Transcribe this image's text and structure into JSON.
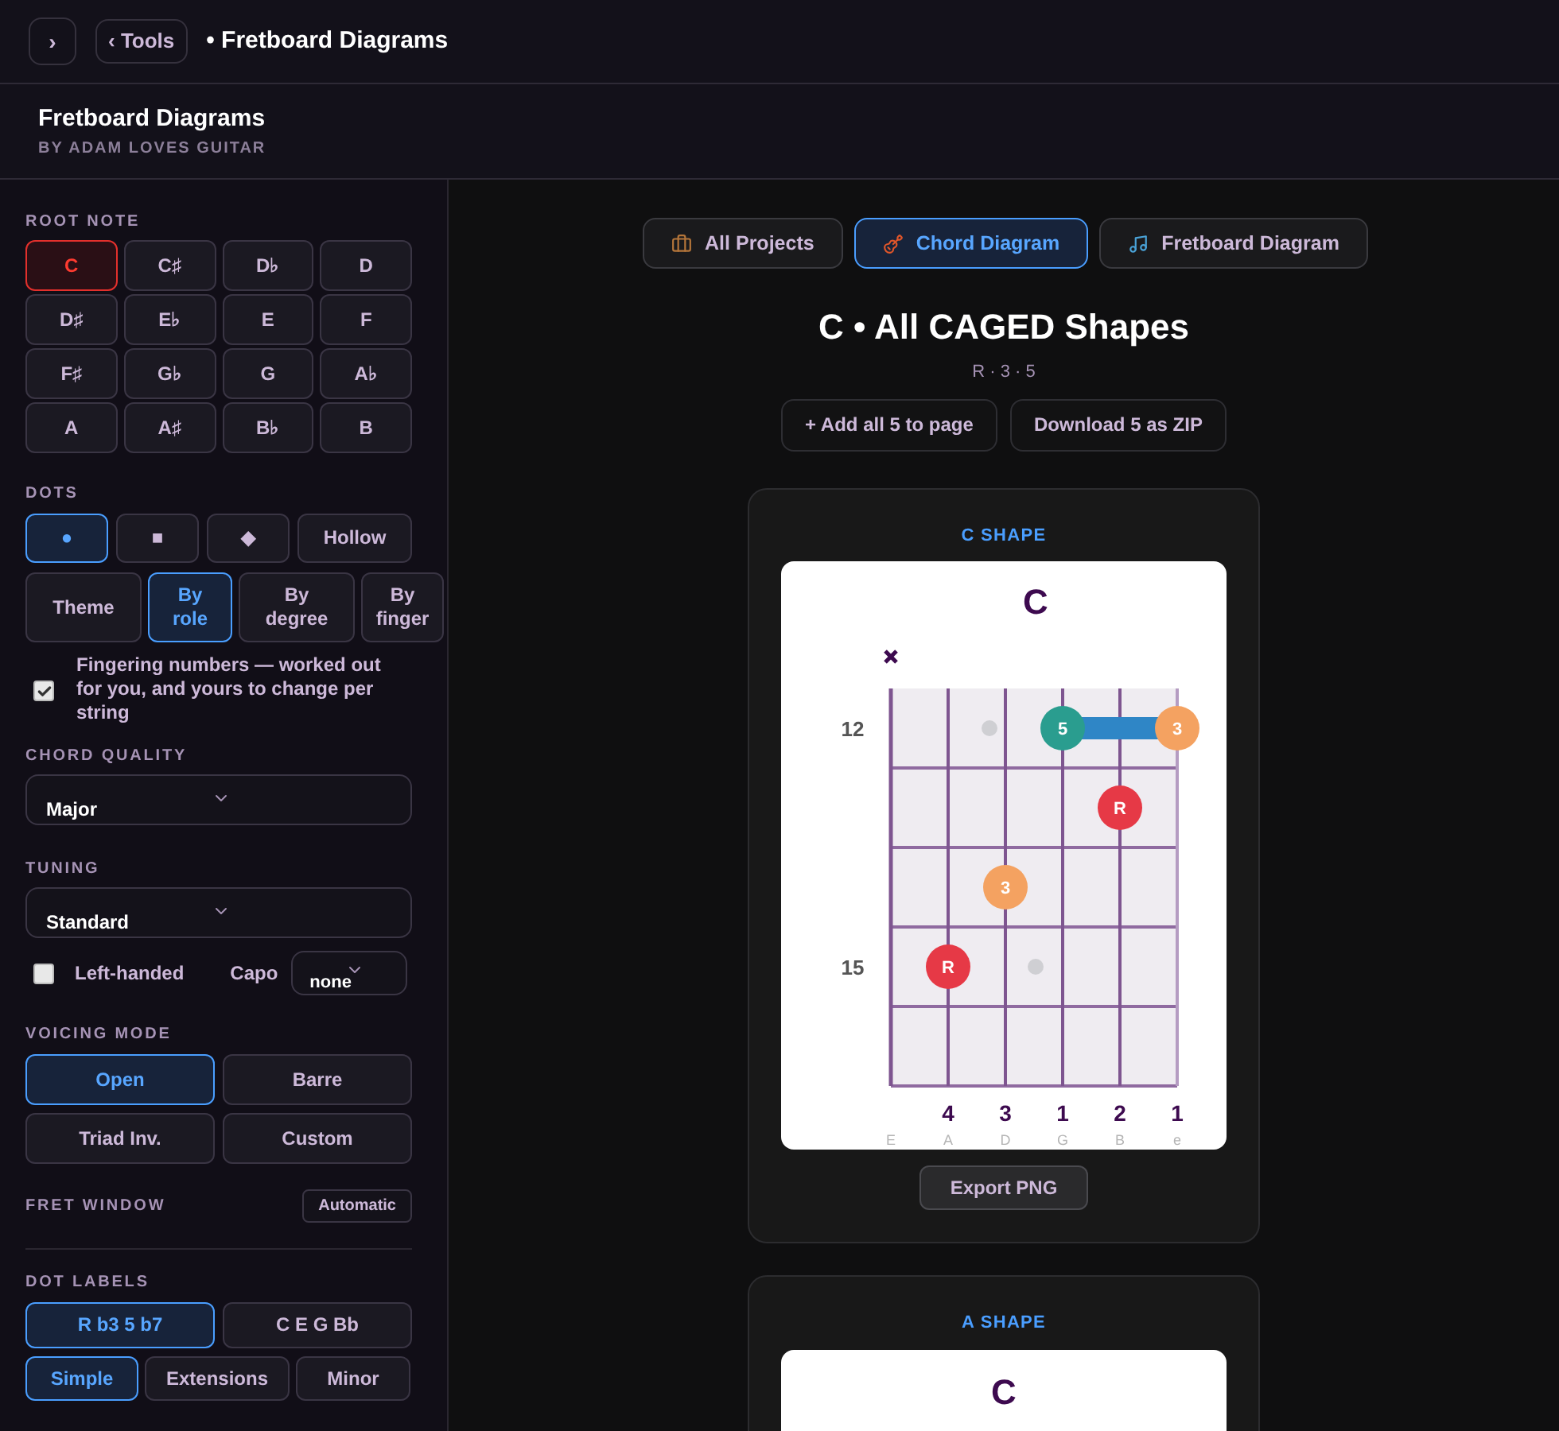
{
  "topbar": {
    "toggle": "›",
    "back": "‹ Tools",
    "breadcrumb": "• Fretboard Diagrams"
  },
  "header": {
    "title": "Fretboard Diagrams",
    "subtitle": "BY ADAM LOVES GUITAR"
  },
  "sidebar": {
    "root_note": {
      "label": "ROOT NOTE",
      "options": [
        {
          "label": "C",
          "selected": true
        },
        {
          "label": "C♯",
          "selected": false
        },
        {
          "label": "D♭",
          "selected": false
        },
        {
          "label": "D",
          "selected": false
        },
        {
          "label": "D♯",
          "selected": false
        },
        {
          "label": "E♭",
          "selected": false
        },
        {
          "label": "E",
          "selected": false
        },
        {
          "label": "F",
          "selected": false
        },
        {
          "label": "F♯",
          "selected": false
        },
        {
          "label": "G♭",
          "selected": false
        },
        {
          "label": "G",
          "selected": false
        },
        {
          "label": "A♭",
          "selected": false
        },
        {
          "label": "A",
          "selected": false
        },
        {
          "label": "A♯",
          "selected": false
        },
        {
          "label": "B♭",
          "selected": false
        },
        {
          "label": "B",
          "selected": false
        }
      ]
    },
    "dots": {
      "label": "DOTS",
      "shapes": [
        {
          "label": "●",
          "selected": true
        },
        {
          "label": "■",
          "selected": false
        },
        {
          "label": "◆",
          "selected": false
        },
        {
          "label": "Hollow",
          "selected": false
        }
      ],
      "coloring": [
        {
          "label": "Theme",
          "selected": false
        },
        {
          "label": "By role",
          "selected": true
        },
        {
          "label": "By degree",
          "selected": false
        },
        {
          "label": "By finger",
          "selected": false
        }
      ]
    },
    "fingering": {
      "label": "Fingering numbers — worked out for you, and yours to change per string",
      "checked": true
    },
    "chord_quality": {
      "label": "CHORD QUALITY",
      "value": "Major"
    },
    "tuning": {
      "label": "TUNING",
      "value": "Standard"
    },
    "left_handed": {
      "label": "Left-handed",
      "checked": false
    },
    "capo": {
      "label": "Capo",
      "value": "none"
    },
    "voicing_mode": {
      "label": "VOICING MODE",
      "options": [
        {
          "label": "Open",
          "selected": true
        },
        {
          "label": "Barre",
          "selected": false
        },
        {
          "label": "Triad Inv.",
          "selected": false
        },
        {
          "label": "Custom",
          "selected": false
        }
      ]
    },
    "fret_window": {
      "label": "FRET WINDOW",
      "value": "Automatic"
    },
    "dot_labels": {
      "label": "DOT LABELS",
      "styles": [
        {
          "label": "R b3 5 b7",
          "selected": true
        },
        {
          "label": "C E G Bb",
          "selected": false
        }
      ],
      "sets": [
        {
          "label": "Simple",
          "selected": true
        },
        {
          "label": "Extensions",
          "selected": false
        },
        {
          "label": "Minor",
          "selected": false
        }
      ]
    }
  },
  "main": {
    "tabs": [
      {
        "label": "All Projects",
        "selected": false
      },
      {
        "label": "Chord Diagram",
        "selected": true
      },
      {
        "label": "Fretboard Diagram",
        "selected": false
      }
    ],
    "title": "C • All CAGED Shapes",
    "formula": "R · 3 · 5",
    "actions": [
      "+ Add all 5 to page",
      "Download 5 as ZIP"
    ],
    "shapes": [
      {
        "title": "C SHAPE",
        "chord": "C",
        "export": "Export PNG",
        "strings": [
          {
            "name": "E",
            "muted": true
          },
          {
            "name": "A",
            "muted": false,
            "finger": "4"
          },
          {
            "name": "D",
            "muted": false,
            "finger": "3"
          },
          {
            "name": "G",
            "muted": false,
            "finger": "1"
          },
          {
            "name": "B",
            "muted": false,
            "finger": "2"
          },
          {
            "name": "e",
            "muted": false,
            "finger": "1"
          }
        ],
        "frets": [
          {
            "label": "12",
            "inlay": true,
            "barre": true,
            "cells": [
              {
                "kind": "empty"
              },
              {
                "kind": "empty"
              },
              {
                "kind": "empty"
              },
              {
                "kind": "dot",
                "label": "5",
                "color": "#2a9d8f"
              },
              {
                "kind": "empty"
              },
              {
                "kind": "dot",
                "label": "3",
                "color": "#f4a261"
              }
            ]
          },
          {
            "inlay": false,
            "barre": false,
            "cells": [
              {
                "kind": "empty"
              },
              {
                "kind": "empty"
              },
              {
                "kind": "empty"
              },
              {
                "kind": "empty"
              },
              {
                "kind": "dot",
                "label": "R",
                "color": "#e63946"
              },
              {
                "kind": "empty"
              }
            ]
          },
          {
            "inlay": false,
            "barre": false,
            "cells": [
              {
                "kind": "empty"
              },
              {
                "kind": "empty"
              },
              {
                "kind": "dot",
                "label": "3",
                "color": "#f4a261"
              },
              {
                "kind": "empty"
              },
              {
                "kind": "empty"
              },
              {
                "kind": "empty"
              }
            ]
          },
          {
            "label": "15",
            "inlay": true,
            "barre": false,
            "cells": [
              {
                "kind": "empty"
              },
              {
                "kind": "dot",
                "label": "R",
                "color": "#e63946"
              },
              {
                "kind": "empty"
              },
              {
                "kind": "empty"
              },
              {
                "kind": "empty"
              },
              {
                "kind": "empty"
              }
            ]
          },
          {
            "inlay": false,
            "barre": false,
            "cells": [
              {
                "kind": "empty"
              },
              {
                "kind": "empty"
              },
              {
                "kind": "empty"
              },
              {
                "kind": "empty"
              },
              {
                "kind": "empty"
              },
              {
                "kind": "empty"
              }
            ]
          }
        ]
      },
      {
        "title": "A SHAPE",
        "chord": "C"
      }
    ]
  }
}
